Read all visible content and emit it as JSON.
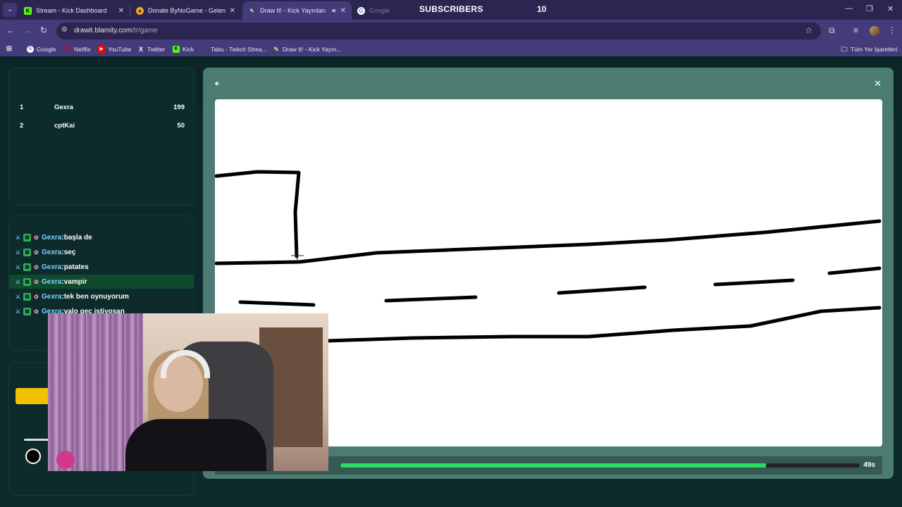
{
  "browser": {
    "tabs": [
      {
        "title": "Stream - Kick Dashboard",
        "favicon": "kick-icon"
      },
      {
        "title": "Donate ByNoGame - Gelen/Gid",
        "favicon": "bynogame-icon"
      },
      {
        "title": "Draw It! - Kick Yayınları İçin",
        "favicon": "drawit-icon",
        "active": true
      },
      {
        "title": "Google",
        "favicon": "google-icon"
      }
    ],
    "overlay_label": "SUBSCRIBERS",
    "overlay_count": "10",
    "url_host": "drawit.blamity.com",
    "url_path": "/tr/game",
    "bookmarks": [
      {
        "label": "Google",
        "icon": "google-icon"
      },
      {
        "label": "Netflix",
        "icon": "netflix-icon"
      },
      {
        "label": "YouTube",
        "icon": "youtube-icon"
      },
      {
        "label": "Twitter",
        "icon": "x-icon"
      },
      {
        "label": "Kick",
        "icon": "kick-icon"
      },
      {
        "label": "Tabu - Twitch Strea...",
        "icon": "tabu-icon"
      },
      {
        "label": "Draw It! - Kick Yayın...",
        "icon": "drawit-icon"
      }
    ],
    "all_bookmarks": "Tüm Yer İşaretleri"
  },
  "scoreboard": [
    {
      "rank": "1",
      "name": "Gexra",
      "points": "199"
    },
    {
      "rank": "2",
      "name": "cptKai",
      "points": "50"
    }
  ],
  "chat": [
    {
      "user": "Gexra",
      "message": "başla de"
    },
    {
      "user": "Gexra",
      "message": "seç"
    },
    {
      "user": "Gexra",
      "message": "patates"
    },
    {
      "user": "Gexra",
      "message": "vampir",
      "highlighted": true
    },
    {
      "user": "Gexra",
      "message": "tek ben oynuyorum"
    },
    {
      "user": "Gexra",
      "message": "valo geç istiyosan"
    }
  ],
  "game": {
    "timer_text": "49s",
    "timer_progress": 0.82
  },
  "colors": {
    "accent_green": "#2bdc62",
    "yellow": "#f2c200",
    "game_panel": "#4c7b71",
    "chat_user": "#79d3ff"
  }
}
